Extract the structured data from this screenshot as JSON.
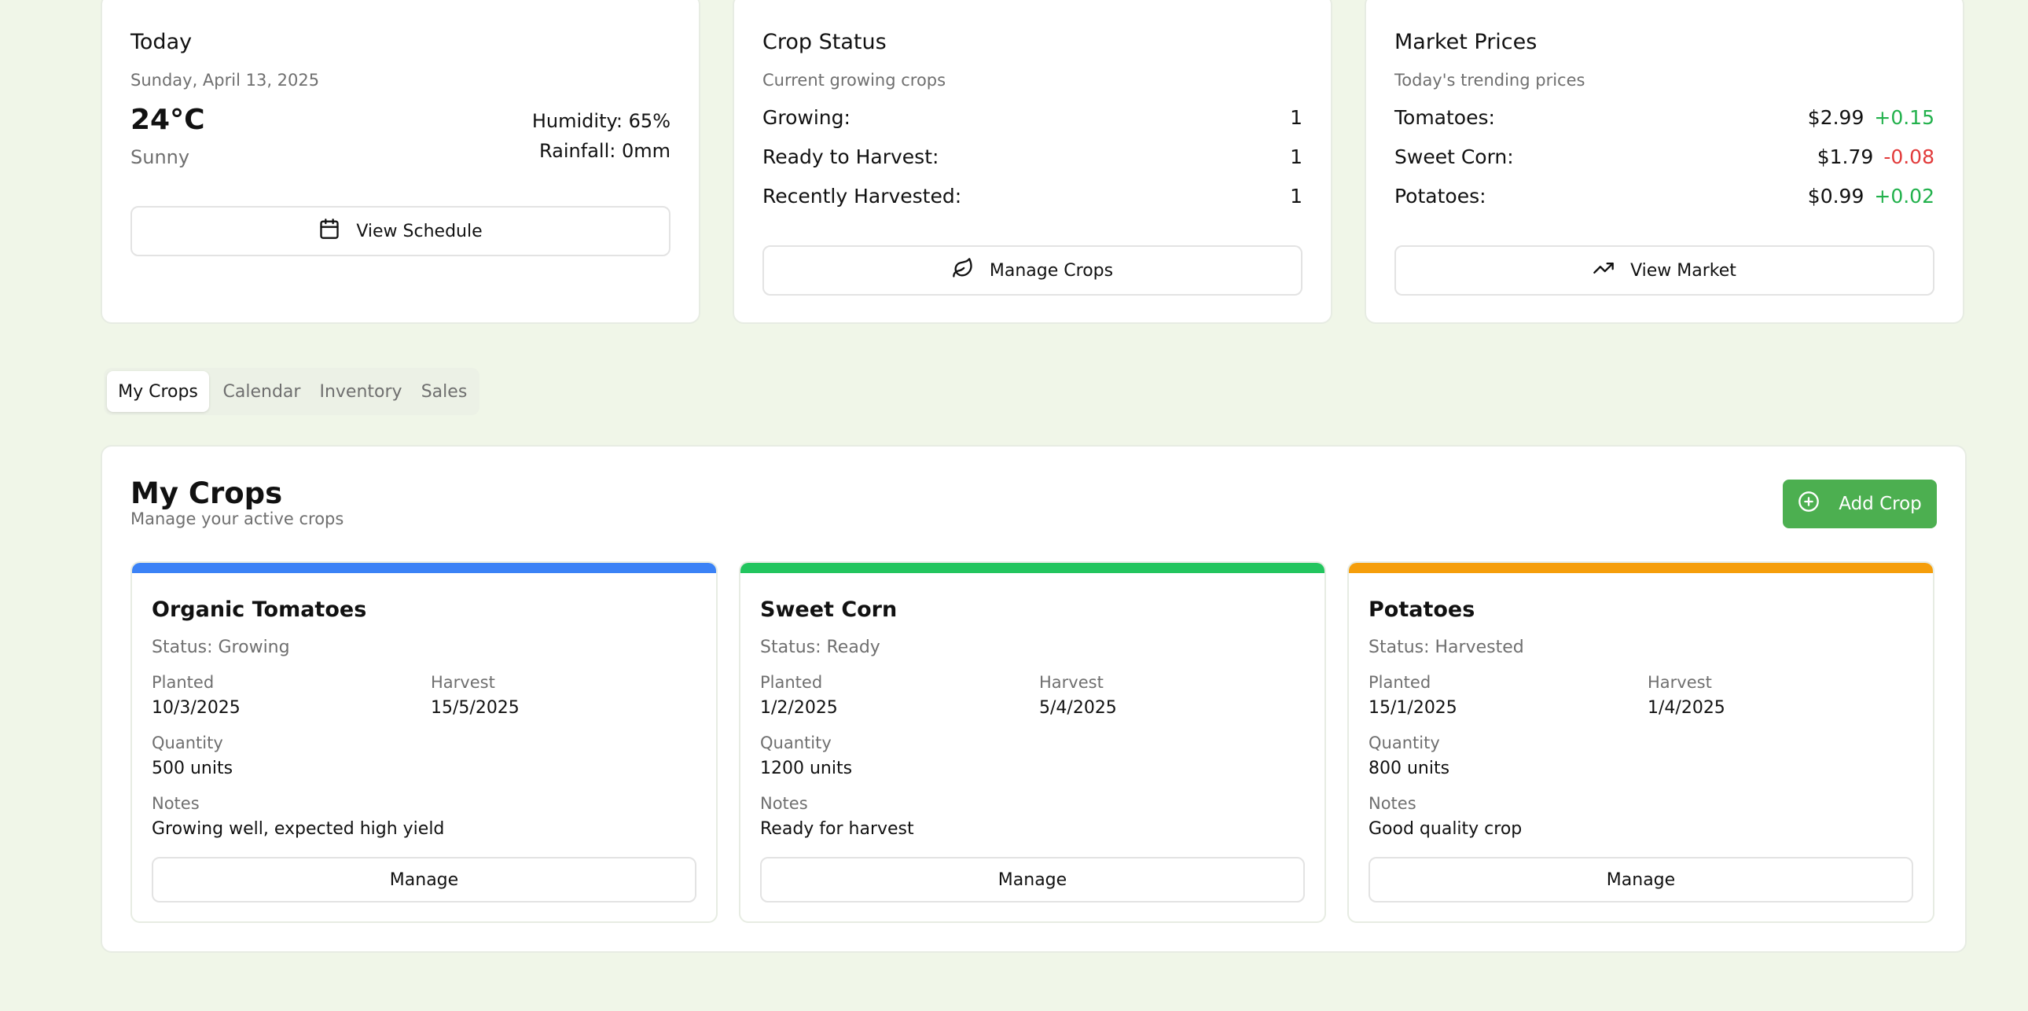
{
  "today": {
    "title": "Today",
    "date": "Sunday, April 13, 2025",
    "temperature": "24°C",
    "condition": "Sunny",
    "humidity": "Humidity: 65%",
    "rainfall": "Rainfall: 0mm",
    "button": "View Schedule",
    "button_icon": "calendar-icon"
  },
  "crop_status": {
    "title": "Crop Status",
    "subtitle": "Current growing crops",
    "rows": [
      {
        "label": "Growing:",
        "value": "1"
      },
      {
        "label": "Ready to Harvest:",
        "value": "1"
      },
      {
        "label": "Recently Harvested:",
        "value": "1"
      }
    ],
    "button": "Manage Crops",
    "button_icon": "leaf-icon"
  },
  "market": {
    "title": "Market Prices",
    "subtitle": "Today's trending prices",
    "rows": [
      {
        "item": "Tomatoes:",
        "price": "$2.99",
        "change": "+0.15",
        "trend": "up"
      },
      {
        "item": "Sweet Corn:",
        "price": "$1.79",
        "change": "-0.08",
        "trend": "down"
      },
      {
        "item": "Potatoes:",
        "price": "$0.99",
        "change": "+0.02",
        "trend": "up"
      }
    ],
    "button": "View Market",
    "button_icon": "trending-up-icon",
    "colors": {
      "up": "#22b14c",
      "down": "#e23b3b"
    }
  },
  "tabs": [
    {
      "label": "My Crops",
      "active": true
    },
    {
      "label": "Calendar",
      "active": false
    },
    {
      "label": "Inventory",
      "active": false
    },
    {
      "label": "Sales",
      "active": false
    }
  ],
  "crops_panel": {
    "title": "My Crops",
    "subtitle": "Manage your active crops",
    "add_button": "Add Crop",
    "add_icon": "plus-circle-icon",
    "accent": "#4caf50",
    "labels": {
      "planted": "Planted",
      "harvest": "Harvest",
      "quantity": "Quantity",
      "notes": "Notes"
    },
    "crops": [
      {
        "name": "Organic Tomatoes",
        "status": "Status: Growing",
        "planted": "10/3/2025",
        "harvest": "15/5/2025",
        "quantity": "500 units",
        "notes": "Growing well, expected high yield",
        "color": "#3b82f6",
        "button": "Manage"
      },
      {
        "name": "Sweet Corn",
        "status": "Status: Ready",
        "planted": "1/2/2025",
        "harvest": "5/4/2025",
        "quantity": "1200 units",
        "notes": "Ready for harvest",
        "color": "#22c55e",
        "button": "Manage"
      },
      {
        "name": "Potatoes",
        "status": "Status: Harvested",
        "planted": "15/1/2025",
        "harvest": "1/4/2025",
        "quantity": "800 units",
        "notes": "Good quality crop",
        "color": "#f59e0b",
        "button": "Manage"
      }
    ]
  }
}
